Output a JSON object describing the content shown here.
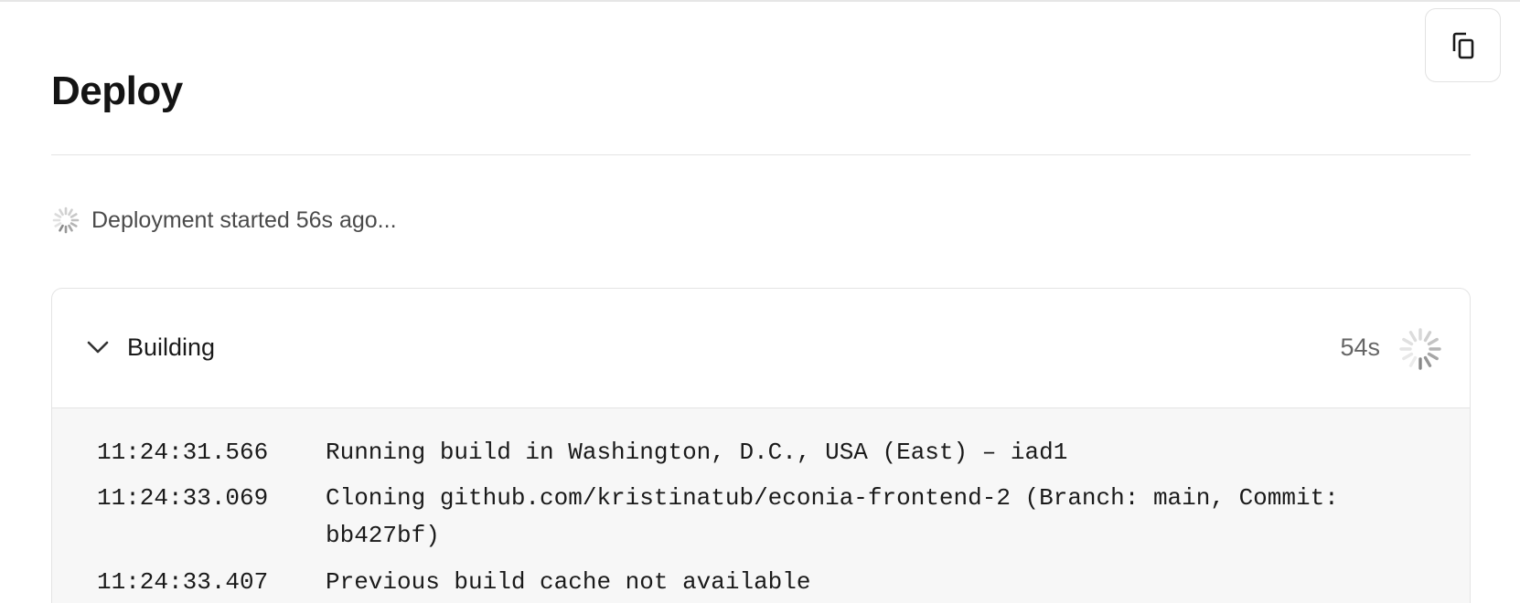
{
  "header": {
    "title": "Deploy",
    "copy_icon": "copy-icon"
  },
  "status": {
    "text": "Deployment started 56s ago...",
    "icon": "spinner-icon"
  },
  "build": {
    "label": "Building",
    "duration": "54s",
    "expand_icon": "chevron-down-icon",
    "status_icon": "spinner-icon"
  },
  "logs": [
    {
      "time": "11:24:31.566",
      "message": "Running build in Washington, D.C., USA (East) – iad1"
    },
    {
      "time": "11:24:33.069",
      "message": "Cloning github.com/kristinatub/econia-frontend-2 (Branch: main, Commit: bb427bf)"
    },
    {
      "time": "11:24:33.407",
      "message": "Previous build cache not available"
    }
  ],
  "colors": {
    "text_primary": "#171717",
    "text_secondary": "#666666",
    "border": "#e4e4e4",
    "log_background": "#f7f7f7"
  }
}
